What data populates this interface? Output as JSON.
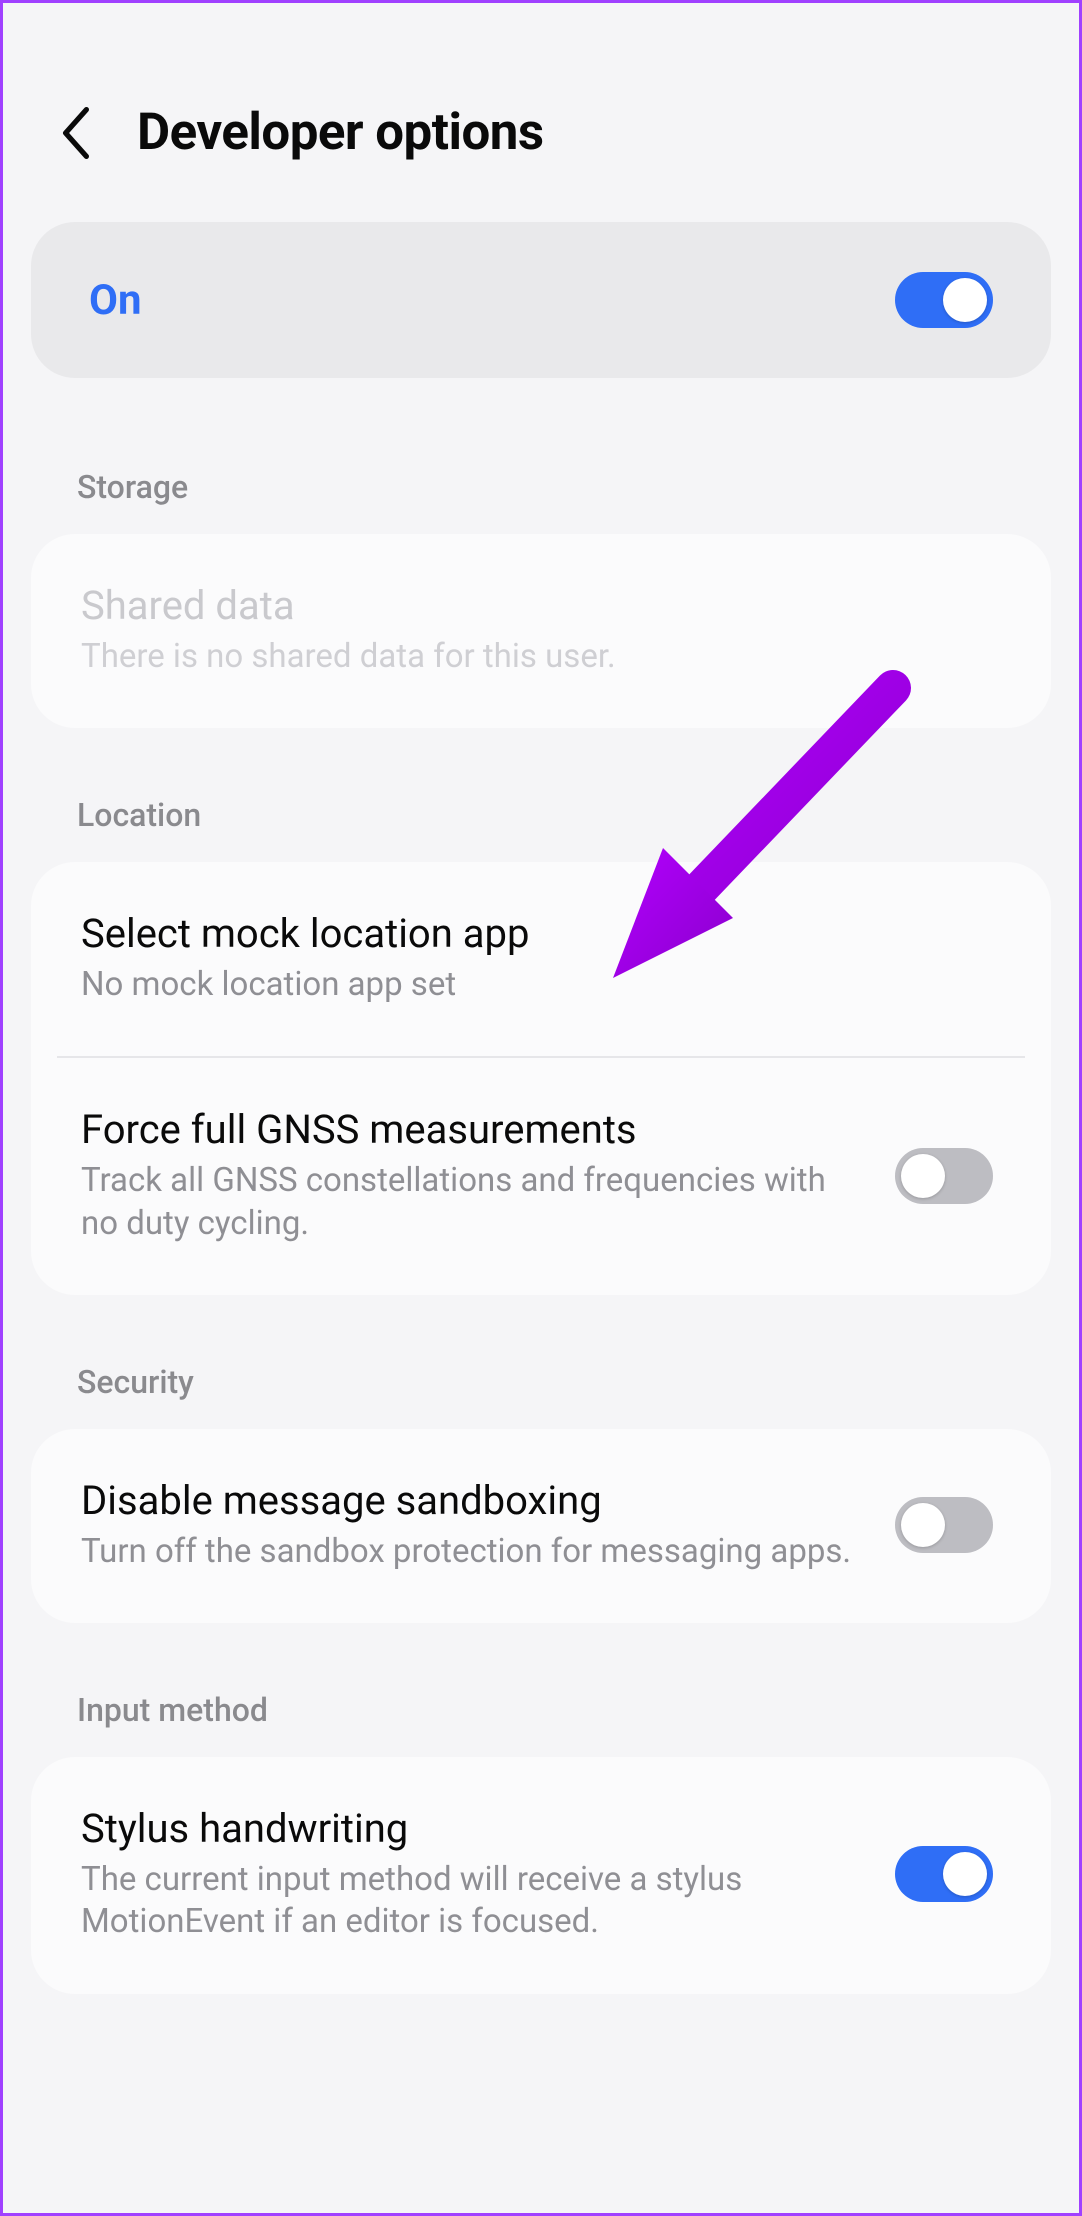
{
  "header": {
    "title": "Developer options"
  },
  "master": {
    "status_label": "On",
    "enabled": true
  },
  "sections": {
    "storage": {
      "header": "Storage",
      "shared_data": {
        "title": "Shared data",
        "sub": "There is no shared data for this user."
      }
    },
    "location": {
      "header": "Location",
      "mock": {
        "title": "Select mock location app",
        "sub": "No mock location app set"
      },
      "gnss": {
        "title": "Force full GNSS measurements",
        "sub": "Track all GNSS constellations and frequencies with no duty cycling.",
        "enabled": false
      }
    },
    "security": {
      "header": "Security",
      "sandbox": {
        "title": "Disable message sandboxing",
        "sub": "Turn off the sandbox protection for messaging apps.",
        "enabled": false
      }
    },
    "input_method": {
      "header": "Input method",
      "stylus": {
        "title": "Stylus handwriting",
        "sub": "The current input method will receive a stylus MotionEvent if an editor is focused.",
        "enabled": true
      }
    }
  },
  "colors": {
    "accent": "#2f6ef6",
    "annotation": "#9d00e8"
  }
}
